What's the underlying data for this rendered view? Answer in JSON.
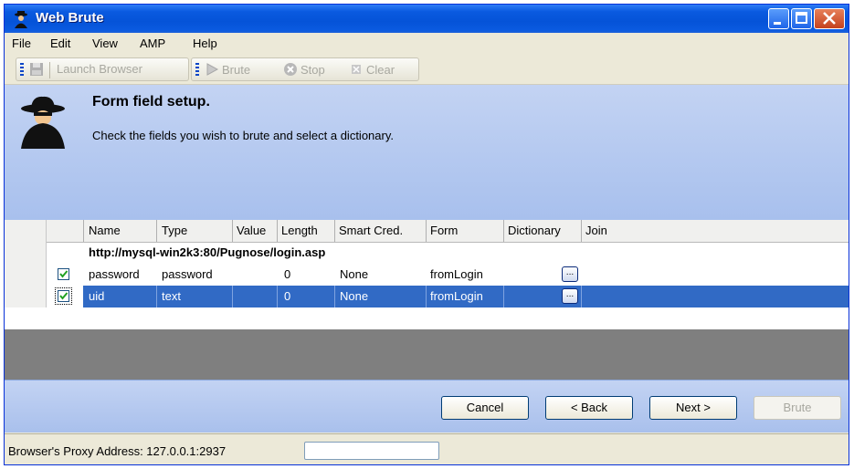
{
  "window": {
    "title": "Web Brute"
  },
  "menu": [
    {
      "label": "File"
    },
    {
      "label": "Edit"
    },
    {
      "label": "View"
    },
    {
      "label": "AMP"
    },
    {
      "label": "Help"
    }
  ],
  "toolbar": {
    "launch_label": "Launch Browser",
    "brute_label": "Brute",
    "stop_label": "Stop",
    "clear_label": "Clear"
  },
  "header": {
    "title": "Form field setup.",
    "description": "Check the fields you wish to brute and select a dictionary."
  },
  "grid": {
    "columns": [
      "Name",
      "Type",
      "Value",
      "Length",
      "Smart Cred.",
      "Form",
      "Dictionary",
      "Join"
    ],
    "group_url": "http://mysql-win2k3:80/Pugnose/login.asp",
    "rows": [
      {
        "checked": true,
        "name": "password",
        "type": "password",
        "value": "",
        "length": "0",
        "smart_cred": "None",
        "form": "fromLogin",
        "dict_button": "..."
      },
      {
        "checked": true,
        "name": "uid",
        "type": "text",
        "value": "",
        "length": "0",
        "smart_cred": "None",
        "form": "fromLogin",
        "dict_button": "..."
      }
    ],
    "selected_row": 1
  },
  "buttons": {
    "cancel": "Cancel",
    "back": "< Back",
    "next": "Next >",
    "brute": "Brute"
  },
  "status": {
    "proxy_label": "Browser's Proxy Address: 127.0.0.1:2937",
    "proxy_value": ""
  },
  "colors": {
    "title_blue": "#0a5ae0",
    "header_bg": "#b6c9ef",
    "selection": "#316ac5",
    "gray_area": "#7f7f7f"
  }
}
